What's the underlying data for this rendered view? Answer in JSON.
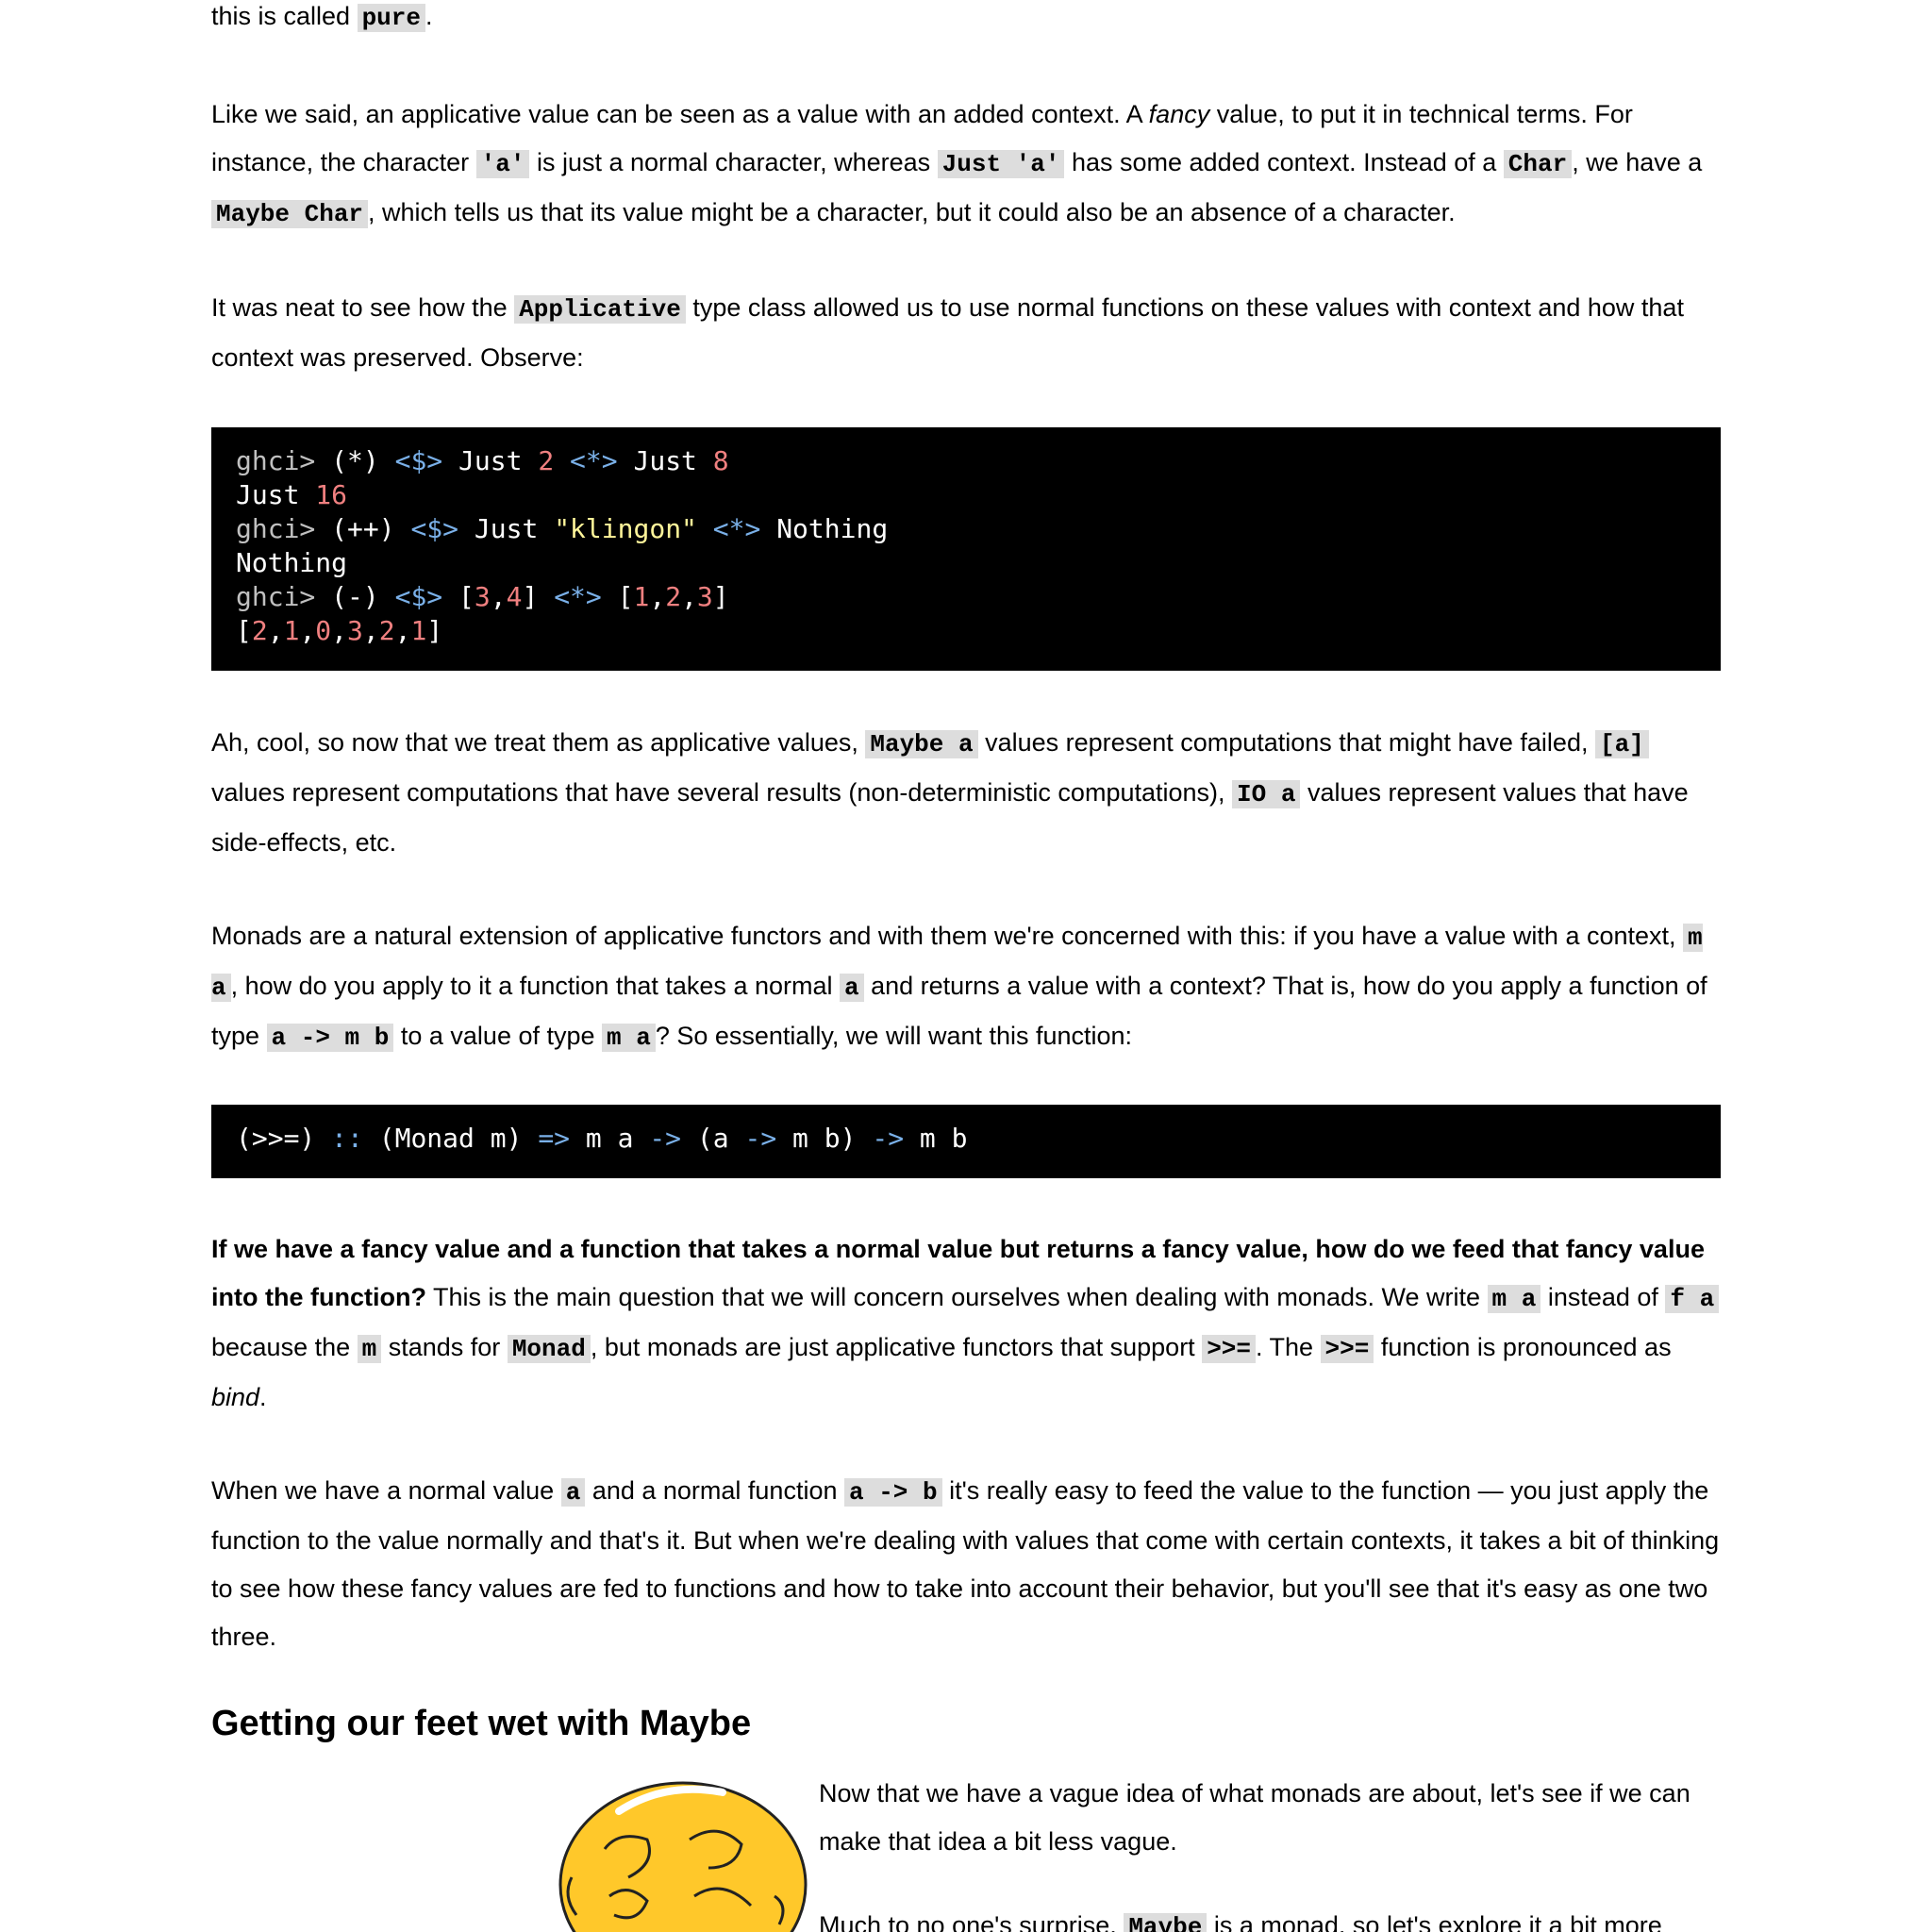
{
  "paragraphs": {
    "p0": {
      "t1": "this is called ",
      "c1": "pure",
      "t2": "."
    },
    "p1": {
      "t1": "Like we said, an applicative value can be seen as a value with an added context. A ",
      "em1": "fancy",
      "t2": " value, to put it in technical terms. For instance, the character ",
      "c1": "'a'",
      "t3": " is just a normal character, whereas ",
      "c2": "Just 'a'",
      "t4": " has some added context. Instead of a ",
      "c3": "Char",
      "t5": ", we have a ",
      "c4": "Maybe Char",
      "t6": ", which tells us that its value might be a character, but it could also be an absence of a character."
    },
    "p2": {
      "t1": "It was neat to see how the ",
      "c1": "Applicative",
      "t2": " type class allowed us to use normal functions on these values with context and how that context was preserved. Observe:"
    },
    "p3": {
      "t1": "Ah, cool, so now that we treat them as applicative values, ",
      "c1": "Maybe a",
      "t2": " values represent computations that might have failed, ",
      "c2": "[a]",
      "t3": " values represent computations that have several results (non-deterministic computations), ",
      "c3": "IO a",
      "t4": " values represent values that have side-effects, etc."
    },
    "p4": {
      "t1": "Monads are a natural extension of applicative functors and with them we're concerned with this: if you have a value with a context, ",
      "c1": "m a",
      "t2": ", how do you apply to it a function that takes a normal ",
      "c2": "a",
      "t3": " and returns a value with a context? That is, how do you apply a function of type ",
      "c3": "a -> m b",
      "t4": " to a value of type ",
      "c4": "m a",
      "t5": "? So essentially, we will want this function:"
    },
    "p5": {
      "b1": "If we have a fancy value and a function that takes a normal value but returns a fancy value, how do we feed that fancy value into the function?",
      "t1": " This is the main question that we will concern ourselves when dealing with monads. We write ",
      "c1": "m a",
      "t2": " instead of ",
      "c2": "f a",
      "t3": " because the ",
      "c3": "m",
      "t4": " stands for ",
      "c4": "Monad",
      "t5": ", but monads are just applicative functors that support ",
      "c5": ">>=",
      "t6": ". The ",
      "c6": ">>=",
      "t7": " function is pronounced as ",
      "em1": "bind",
      "t8": "."
    },
    "p6": {
      "t1": "When we have a normal value ",
      "c1": "a",
      "t2": " and a normal function ",
      "c2": "a -> b",
      "t3": " it's really easy to feed the value to the function — you just apply the function to the value normally and that's it. But when we're dealing with values that come with certain contexts, it takes a bit of thinking to see how these fancy values are fed to functions and how to take into account their behavior, but you'll see that it's easy as one two three."
    },
    "p7": {
      "t1": "Now that we have a vague idea of what monads are about, let's see if we can make that idea a bit less vague."
    },
    "p8": {
      "t1": "Much to no one's surprise, ",
      "c1": "Maybe",
      "t2": " is a monad, so let's explore it a bit more"
    }
  },
  "heading": "Getting our feet wet with Maybe",
  "code1": {
    "l1": {
      "prompt": "ghci>",
      "a": " (*) ",
      "op1": "<$>",
      "b": " Just ",
      "n1": "2",
      "c": " ",
      "op2": "<*>",
      "d": " Just ",
      "n2": "8"
    },
    "l2": {
      "a": "Just ",
      "n1": "16"
    },
    "l3": {
      "prompt": "ghci>",
      "a": " (++) ",
      "op1": "<$>",
      "b": " Just ",
      "s1": "\"klingon\"",
      "c": " ",
      "op2": "<*>",
      "d": " Nothing"
    },
    "l4": {
      "a": "Nothing"
    },
    "l5": {
      "prompt": "ghci>",
      "a": " (-) ",
      "op1": "<$>",
      "b": " [",
      "n1": "3",
      "c1": ",",
      "n2": "4",
      "d": "] ",
      "op2": "<*>",
      "e": " [",
      "n3": "1",
      "c2": ",",
      "n4": "2",
      "c3": ",",
      "n5": "3",
      "f": "]"
    },
    "l6": {
      "a": "[",
      "n1": "2",
      "c1": ",",
      "n2": "1",
      "c2": ",",
      "n3": "0",
      "c3": ",",
      "n4": "3",
      "c4": ",",
      "n5": "2",
      "c5": ",",
      "n6": "1",
      "b": "]"
    }
  },
  "code2": {
    "a": "(>>=) ",
    "op1": "::",
    "b": " (Monad m) ",
    "op2": "=>",
    "c": " m a ",
    "op3": "->",
    "d": " (a ",
    "op4": "->",
    "e": " m b) ",
    "op5": "->",
    "f": " m b"
  },
  "image": {
    "icon": "maybe-cartoon-icon",
    "color": "#ffc82a"
  }
}
